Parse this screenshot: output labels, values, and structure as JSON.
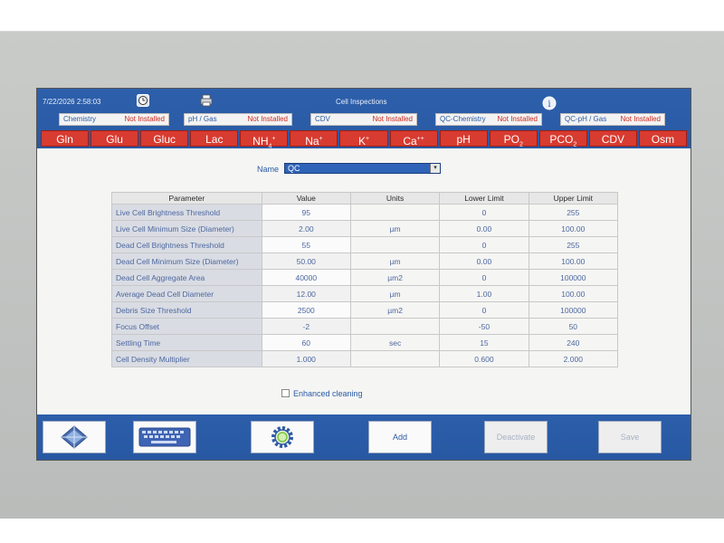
{
  "header": {
    "datetime": "7/22/2026  2:58:03",
    "title": "Cell Inspections",
    "status": [
      {
        "label": "Chemistry",
        "value": "Not Installed"
      },
      {
        "label": "pH / Gas",
        "value": "Not Installed"
      },
      {
        "label": "CDV",
        "value": "Not Installed"
      },
      {
        "label": "QC-Chemistry",
        "value": "Not Installed"
      },
      {
        "label": "QC-pH / Gas",
        "value": "Not Installed"
      }
    ]
  },
  "analytes": [
    {
      "text": "Gln"
    },
    {
      "text": "Glu"
    },
    {
      "text": "Gluc"
    },
    {
      "text": "Lac"
    },
    {
      "text": "NH",
      "sub": "4",
      "sup": "+"
    },
    {
      "text": "Na",
      "sup": "+"
    },
    {
      "text": "K",
      "sup": "+"
    },
    {
      "text": "Ca",
      "sup": "++"
    },
    {
      "text": "pH"
    },
    {
      "text": "PO",
      "sub": "2"
    },
    {
      "text": "PCO",
      "sub": "2"
    },
    {
      "text": "CDV"
    },
    {
      "text": "Osm"
    }
  ],
  "name": {
    "label": "Name",
    "value": "QC"
  },
  "table": {
    "headers": [
      "Parameter",
      "Value",
      "Units",
      "Lower Limit",
      "Upper Limit"
    ],
    "rows": [
      [
        "Live Cell Brightness Threshold",
        "95",
        "",
        "0",
        "255"
      ],
      [
        "Live Cell Minimum Size (Diameter)",
        "2.00",
        "µm",
        "0.00",
        "100.00"
      ],
      [
        "Dead Cell Brightness Threshold",
        "55",
        "",
        "0",
        "255"
      ],
      [
        "Dead Cell Minimum Size (Diameter)",
        "50.00",
        "µm",
        "0.00",
        "100.00"
      ],
      [
        "Dead Cell Aggregate Area",
        "40000",
        "µm2",
        "0",
        "100000"
      ],
      [
        "Average Dead Cell Diameter",
        "12.00",
        "µm",
        "1.00",
        "100.00"
      ],
      [
        "Debris Size Threshold",
        "2500",
        "µm2",
        "0",
        "100000"
      ],
      [
        "Focus Offset",
        "-2",
        "",
        "-50",
        "50"
      ],
      [
        "Settling Time",
        "60",
        "sec",
        "15",
        "240"
      ],
      [
        "Cell Density Multiplier",
        "1.000",
        "",
        "0.600",
        "2.000"
      ]
    ]
  },
  "enhanced_cleaning": {
    "label": "Enhanced cleaning",
    "checked": false
  },
  "footer": {
    "add_label": "Add",
    "deactivate_label": "Deactivate",
    "save_label": "Save"
  },
  "icons": [
    "clock-icon",
    "printer-icon",
    "info-icon",
    "navigation-icon",
    "keyboard-icon",
    "settings-gear-icon"
  ],
  "colors": {
    "header_blue": "#2a5aa4",
    "analyte_red": "#d83b30",
    "status_red": "#cc2a1f"
  }
}
